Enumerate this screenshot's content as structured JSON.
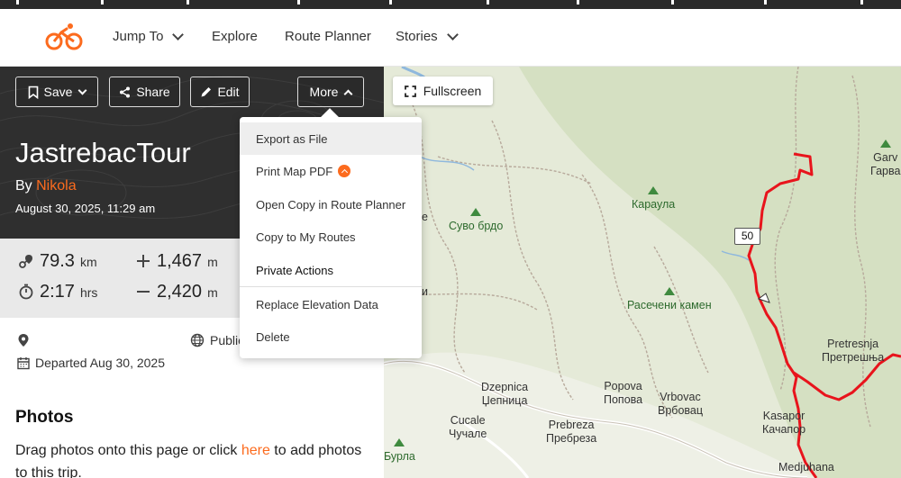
{
  "nav": {
    "items": [
      {
        "label": "Jump To",
        "has_dropdown": true
      },
      {
        "label": "Explore",
        "has_dropdown": false
      },
      {
        "label": "Route Planner",
        "has_dropdown": false
      },
      {
        "label": "Stories",
        "has_dropdown": true
      }
    ],
    "logo_icon": "cyclist-icon",
    "accent_color": "#fc6b1e"
  },
  "toolbar": {
    "save_label": "Save",
    "share_label": "Share",
    "edit_label": "Edit",
    "more_label": "More"
  },
  "trip": {
    "title": "JastrebacTour",
    "by_prefix": "By",
    "author": "Nikola",
    "date": "August 30, 2025, 11:29 am"
  },
  "stats": {
    "distance": {
      "value": "79.3",
      "unit": "km"
    },
    "elevation_gain": {
      "value": "1,467",
      "unit": "m"
    },
    "duration": {
      "value": "2:17",
      "unit": "hrs"
    },
    "elevation_loss": {
      "value": "2,420",
      "unit": "m"
    }
  },
  "meta": {
    "visibility": "Public",
    "departed": "Departed Aug 30, 2025"
  },
  "photos": {
    "heading": "Photos",
    "text_before": "Drag photos onto this page or click ",
    "link": "here",
    "text_after": " to add photos to this trip."
  },
  "more_menu": {
    "items": [
      {
        "label": "Export as File",
        "active": true
      },
      {
        "label": "Print Map PDF",
        "badge": true
      },
      {
        "label": "Open Copy in Route Planner"
      },
      {
        "label": "Copy to My Routes"
      },
      {
        "label": "Private Actions",
        "strong": true
      },
      {
        "label": "Replace Elevation Data"
      },
      {
        "label": "Delete"
      }
    ]
  },
  "map": {
    "fullscreen_label": "Fullscreen",
    "km_marker": "50",
    "route_color": "#e8141c",
    "labels": {
      "garv": "Garv",
      "garv_cyr": "Гарва",
      "karaula": "Караула",
      "suvo_brdo": "Суво брдо",
      "raseceni_kamen": "Расечени камен",
      "pretresnja": "Pretresnja",
      "pretresnja_cyr": "Претрешња",
      "dzepnica": "Dzepnica",
      "dzepnica_cyr": "Џепница",
      "popova": "Popova",
      "popova_cyr": "Попова",
      "vrbovac": "Vrbovac",
      "vrbovac_cyr": "Врбовац",
      "kasapor": "Kasapor",
      "kasapor_cyr": "Качапор",
      "cucale": "Cucale",
      "cucale_cyr": "Чучале",
      "prebreza": "Prebreza",
      "prebreza_cyr": "Пребреза",
      "burla": "Бурла",
      "medjuhana": "Medjuhana",
      "edge_e": "е",
      "edge_i": "и"
    }
  }
}
